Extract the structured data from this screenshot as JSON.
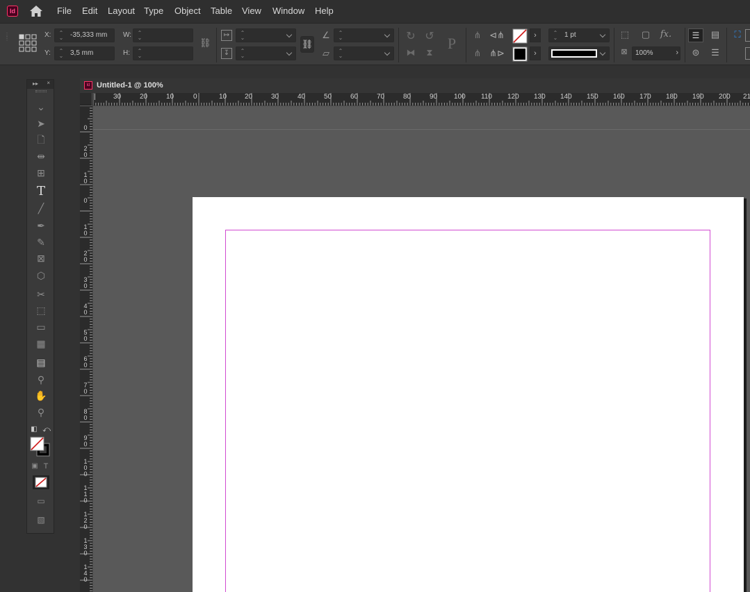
{
  "app": {
    "logo_text": "Id"
  },
  "menu": {
    "items": [
      "File",
      "Edit",
      "Layout",
      "Type",
      "Object",
      "Table",
      "View",
      "Window",
      "Help"
    ]
  },
  "control": {
    "x_label": "X:",
    "x_value": "-35,333 mm",
    "y_label": "Y:",
    "y_value": "3,5 mm",
    "w_label": "W:",
    "w_value": "",
    "h_label": "H:",
    "h_value": "",
    "stroke_weight": "1 pt",
    "opacity": "100%",
    "fx_label": "fx."
  },
  "document": {
    "tab_title": "Untitled-1 @ 100%"
  },
  "ruler": {
    "horizontal": [
      "30",
      "20",
      "10",
      "0",
      "10",
      "20",
      "30",
      "40",
      "50",
      "60",
      "70",
      "80",
      "90",
      "100",
      "110",
      "120",
      "130",
      "140",
      "150",
      "160",
      "170",
      "180",
      "190",
      "200",
      "21"
    ],
    "vertical": [
      "0",
      "20",
      "10",
      "0",
      "10",
      "20",
      "30",
      "40",
      "50",
      "60",
      "70",
      "80",
      "90",
      "100",
      "110",
      "120",
      "130",
      "140"
    ]
  },
  "tools": [
    "selection-tool",
    "direct-selection-tool",
    "page-tool",
    "gap-tool",
    "content-collector-tool",
    "type-tool",
    "line-tool",
    "pen-tool",
    "pencil-tool",
    "rectangle-frame-tool",
    "ellipse-tool",
    "scissors-tool",
    "free-transform-tool",
    "gradient-swatch-tool",
    "gradient-feather-tool",
    "note-tool",
    "eyedropper-tool",
    "hand-tool",
    "zoom-tool"
  ],
  "colors": {
    "margin_guide": "#d14ad1",
    "page": "#ffffff",
    "pasteboard": "#595959",
    "accent": "#2d8ceb"
  }
}
